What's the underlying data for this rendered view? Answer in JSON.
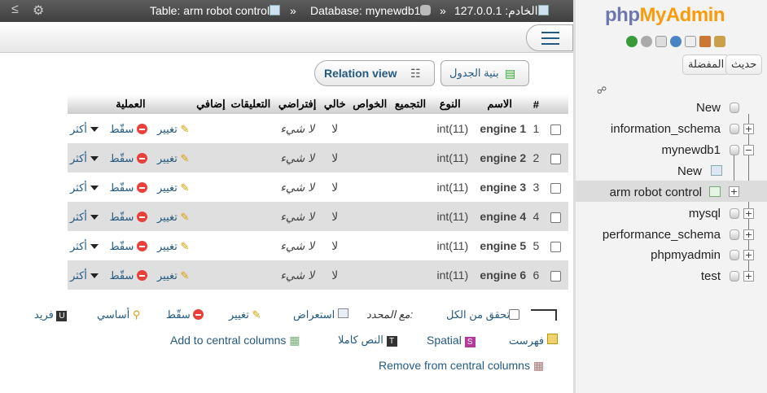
{
  "topbar": {
    "server": "الخادم: 127.0.0.1",
    "database": "Database: mynewdb1",
    "table": "Table: arm robot control",
    "sep": "»"
  },
  "buttons": {
    "relation_view": "Relation view",
    "table_structure": "بنية الجدول"
  },
  "columns": {
    "num": "#",
    "name": "الاسم",
    "type": "النوع",
    "collation": "التجميع",
    "attributes": "الخواص",
    "null": "خالي",
    "default": "إفتراضي",
    "comments": "التعليقات",
    "extra": "إضافي",
    "action": "العملية"
  },
  "rows": [
    {
      "num": "1",
      "name": "engine 1",
      "type": "int(11)",
      "null": "لا",
      "default": "لا شيء"
    },
    {
      "num": "2",
      "name": "engine 2",
      "type": "int(11)",
      "null": "لا",
      "default": "لا شيء"
    },
    {
      "num": "3",
      "name": "engine 3",
      "type": "int(11)",
      "null": "لا",
      "default": "لا شيء"
    },
    {
      "num": "4",
      "name": "engine 4",
      "type": "int(11)",
      "null": "لا",
      "default": "لا شيء"
    },
    {
      "num": "5",
      "name": "engine 5",
      "type": "int(11)",
      "null": "لا",
      "default": "لا شيء"
    },
    {
      "num": "6",
      "name": "engine 6",
      "type": "int(11)",
      "null": "لا",
      "default": "لا شيء"
    }
  ],
  "row_actions": {
    "change": "تغيير",
    "drop": "سقّط",
    "more": "أكثر"
  },
  "footer": {
    "check_all": "تحقق من الكل",
    "with_selected": "مع المحدد:",
    "browse": "استعراض",
    "change": "تغيير",
    "drop": "سقّط",
    "primary": "أساسي",
    "unique": "فريد",
    "index": "فهرست",
    "spatial": "Spatial",
    "fulltext": "النص كاملا",
    "add_central": "Add to central columns",
    "remove_central": "Remove from central columns"
  },
  "nav": {
    "logo_php": "php",
    "logo_myadmin": "MyAdmin",
    "tab_recent": "حديث",
    "tab_favorites": "المفضلة",
    "items": {
      "new_root": "New",
      "information_schema": "information_schema",
      "mynewdb1": "mynewdb1",
      "new_table": "New",
      "arm_robot_control": "arm robot control",
      "mysql": "mysql",
      "performance_schema": "performance_schema",
      "phpmyadmin": "phpmyadmin",
      "test": "test"
    }
  },
  "colors": {
    "link": "#235a81",
    "logo_php": "#6c78af",
    "logo_myadmin": "#f89c0e",
    "even_row": "#dfdfdf"
  }
}
